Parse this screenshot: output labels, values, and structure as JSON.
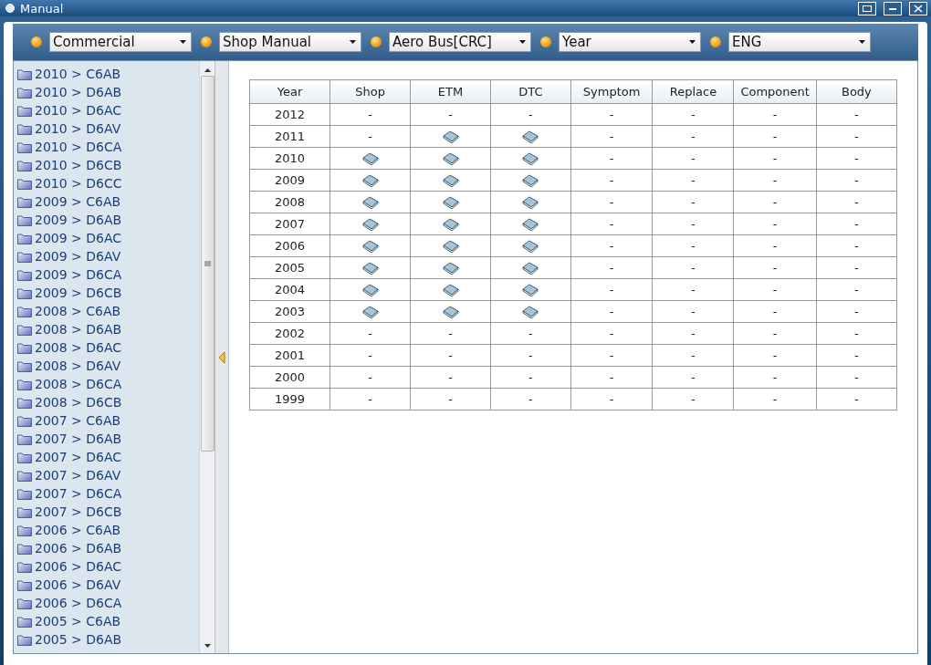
{
  "window": {
    "title": "Manual"
  },
  "toolbar": {
    "dropdowns": [
      {
        "value": "Commercial"
      },
      {
        "value": "Shop Manual"
      },
      {
        "value": "Aero Bus[CRC]"
      },
      {
        "value": "Year"
      },
      {
        "value": "ENG"
      }
    ]
  },
  "sidebar": {
    "items": [
      "2010 > C6AB",
      "2010 > D6AB",
      "2010 > D6AC",
      "2010 > D6AV",
      "2010 > D6CA",
      "2010 > D6CB",
      "2010 > D6CC",
      "2009 > C6AB",
      "2009 > D6AB",
      "2009 > D6AC",
      "2009 > D6AV",
      "2009 > D6CA",
      "2009 > D6CB",
      "2008 > C6AB",
      "2008 > D6AB",
      "2008 > D6AC",
      "2008 > D6AV",
      "2008 > D6CA",
      "2008 > D6CB",
      "2007 > C6AB",
      "2007 > D6AB",
      "2007 > D6AC",
      "2007 > D6AV",
      "2007 > D6CA",
      "2007 > D6CB",
      "2006 > C6AB",
      "2006 > D6AB",
      "2006 > D6AC",
      "2006 > D6AV",
      "2006 > D6CA",
      "2005 > C6AB",
      "2005 > D6AB"
    ]
  },
  "table": {
    "columns": [
      "Year",
      "Shop",
      "ETM",
      "DTC",
      "Symptom",
      "Replace",
      "Component",
      "Body"
    ],
    "rows": [
      {
        "cells": [
          {
            "kind": "text",
            "text": "2012"
          },
          {
            "kind": "text",
            "text": "-"
          },
          {
            "kind": "text",
            "text": "-"
          },
          {
            "kind": "text",
            "text": "-"
          },
          {
            "kind": "text",
            "text": "-"
          },
          {
            "kind": "text",
            "text": "-"
          },
          {
            "kind": "text",
            "text": "-"
          },
          {
            "kind": "text",
            "text": "-"
          }
        ]
      },
      {
        "cells": [
          {
            "kind": "text",
            "text": "2011"
          },
          {
            "kind": "text",
            "text": "-"
          },
          {
            "kind": "book"
          },
          {
            "kind": "book"
          },
          {
            "kind": "text",
            "text": "-"
          },
          {
            "kind": "text",
            "text": "-"
          },
          {
            "kind": "text",
            "text": "-"
          },
          {
            "kind": "text",
            "text": "-"
          }
        ]
      },
      {
        "cells": [
          {
            "kind": "text",
            "text": "2010"
          },
          {
            "kind": "book"
          },
          {
            "kind": "book"
          },
          {
            "kind": "book"
          },
          {
            "kind": "text",
            "text": "-"
          },
          {
            "kind": "text",
            "text": "-"
          },
          {
            "kind": "text",
            "text": "-"
          },
          {
            "kind": "text",
            "text": "-"
          }
        ]
      },
      {
        "cells": [
          {
            "kind": "text",
            "text": "2009"
          },
          {
            "kind": "book"
          },
          {
            "kind": "book"
          },
          {
            "kind": "book"
          },
          {
            "kind": "text",
            "text": "-"
          },
          {
            "kind": "text",
            "text": "-"
          },
          {
            "kind": "text",
            "text": "-"
          },
          {
            "kind": "text",
            "text": "-"
          }
        ]
      },
      {
        "cells": [
          {
            "kind": "text",
            "text": "2008"
          },
          {
            "kind": "book"
          },
          {
            "kind": "book"
          },
          {
            "kind": "book"
          },
          {
            "kind": "text",
            "text": "-"
          },
          {
            "kind": "text",
            "text": "-"
          },
          {
            "kind": "text",
            "text": "-"
          },
          {
            "kind": "text",
            "text": "-"
          }
        ]
      },
      {
        "cells": [
          {
            "kind": "text",
            "text": "2007"
          },
          {
            "kind": "book"
          },
          {
            "kind": "book"
          },
          {
            "kind": "book"
          },
          {
            "kind": "text",
            "text": "-"
          },
          {
            "kind": "text",
            "text": "-"
          },
          {
            "kind": "text",
            "text": "-"
          },
          {
            "kind": "text",
            "text": "-"
          }
        ]
      },
      {
        "cells": [
          {
            "kind": "text",
            "text": "2006"
          },
          {
            "kind": "book"
          },
          {
            "kind": "book"
          },
          {
            "kind": "book"
          },
          {
            "kind": "text",
            "text": "-"
          },
          {
            "kind": "text",
            "text": "-"
          },
          {
            "kind": "text",
            "text": "-"
          },
          {
            "kind": "text",
            "text": "-"
          }
        ]
      },
      {
        "cells": [
          {
            "kind": "text",
            "text": "2005"
          },
          {
            "kind": "book"
          },
          {
            "kind": "book"
          },
          {
            "kind": "book"
          },
          {
            "kind": "text",
            "text": "-"
          },
          {
            "kind": "text",
            "text": "-"
          },
          {
            "kind": "text",
            "text": "-"
          },
          {
            "kind": "text",
            "text": "-"
          }
        ]
      },
      {
        "cells": [
          {
            "kind": "text",
            "text": "2004"
          },
          {
            "kind": "book"
          },
          {
            "kind": "book"
          },
          {
            "kind": "book"
          },
          {
            "kind": "text",
            "text": "-"
          },
          {
            "kind": "text",
            "text": "-"
          },
          {
            "kind": "text",
            "text": "-"
          },
          {
            "kind": "text",
            "text": "-"
          }
        ]
      },
      {
        "cells": [
          {
            "kind": "text",
            "text": "2003"
          },
          {
            "kind": "book"
          },
          {
            "kind": "book"
          },
          {
            "kind": "book"
          },
          {
            "kind": "text",
            "text": "-"
          },
          {
            "kind": "text",
            "text": "-"
          },
          {
            "kind": "text",
            "text": "-"
          },
          {
            "kind": "text",
            "text": "-"
          }
        ]
      },
      {
        "cells": [
          {
            "kind": "text",
            "text": "2002"
          },
          {
            "kind": "text",
            "text": "-"
          },
          {
            "kind": "text",
            "text": "-"
          },
          {
            "kind": "text",
            "text": "-"
          },
          {
            "kind": "text",
            "text": "-"
          },
          {
            "kind": "text",
            "text": "-"
          },
          {
            "kind": "text",
            "text": "-"
          },
          {
            "kind": "text",
            "text": "-"
          }
        ]
      },
      {
        "cells": [
          {
            "kind": "text",
            "text": "2001"
          },
          {
            "kind": "text",
            "text": "-"
          },
          {
            "kind": "text",
            "text": "-"
          },
          {
            "kind": "text",
            "text": "-"
          },
          {
            "kind": "text",
            "text": "-"
          },
          {
            "kind": "text",
            "text": "-"
          },
          {
            "kind": "text",
            "text": "-"
          },
          {
            "kind": "text",
            "text": "-"
          }
        ]
      },
      {
        "cells": [
          {
            "kind": "text",
            "text": "2000"
          },
          {
            "kind": "text",
            "text": "-"
          },
          {
            "kind": "text",
            "text": "-"
          },
          {
            "kind": "text",
            "text": "-"
          },
          {
            "kind": "text",
            "text": "-"
          },
          {
            "kind": "text",
            "text": "-"
          },
          {
            "kind": "text",
            "text": "-"
          },
          {
            "kind": "text",
            "text": "-"
          }
        ]
      },
      {
        "cells": [
          {
            "kind": "text",
            "text": "1999"
          },
          {
            "kind": "text",
            "text": "-"
          },
          {
            "kind": "text",
            "text": "-"
          },
          {
            "kind": "text",
            "text": "-"
          },
          {
            "kind": "text",
            "text": "-"
          },
          {
            "kind": "text",
            "text": "-"
          },
          {
            "kind": "text",
            "text": "-"
          },
          {
            "kind": "text",
            "text": "-"
          }
        ]
      }
    ]
  }
}
